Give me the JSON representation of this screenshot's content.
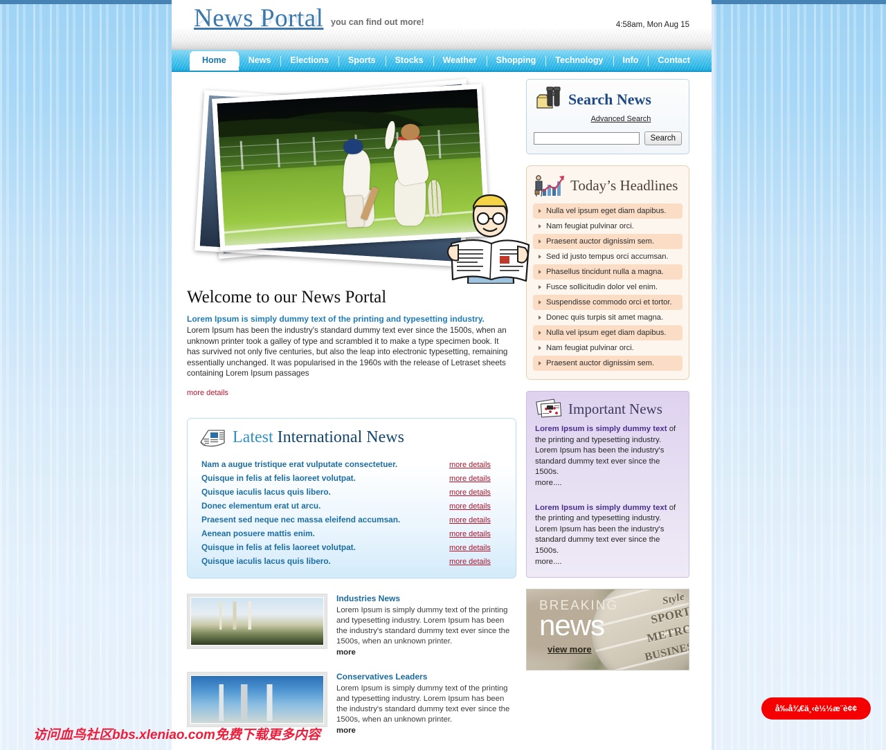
{
  "site": {
    "title": "News Portal",
    "tagline": "you can find out more!",
    "datetime": "4:58am, Mon Aug 15"
  },
  "nav": {
    "items": [
      {
        "label": "Home",
        "active": true
      },
      {
        "label": "News",
        "active": false
      },
      {
        "label": "Elections",
        "active": false
      },
      {
        "label": "Sports",
        "active": false
      },
      {
        "label": "Stocks",
        "active": false
      },
      {
        "label": "Weather",
        "active": false
      },
      {
        "label": "Shopping",
        "active": false
      },
      {
        "label": "Technology",
        "active": false
      },
      {
        "label": "Info",
        "active": false
      },
      {
        "label": "Contact",
        "active": false
      }
    ]
  },
  "hero": {
    "alt": "cricket-match-photo-stack"
  },
  "welcome": {
    "title": "Welcome to our News Portal",
    "lead": "Lorem Ipsum is simply dummy text of the printing and typesetting industry.",
    "body": "Lorem Ipsum has been the industry's standard dummy text ever since the 1500s, when an unknown printer took a galley of type and scrambled it to make a type specimen book. It has survived not only five centuries, but also the leap into electronic typesetting, remaining essentially unchanged. It was popularised in the 1960s with the release of Letraset sheets containing Lorem Ipsum passages",
    "more_label": "more details"
  },
  "international": {
    "title_highlight": "Latest",
    "title_rest": " International News",
    "more_label": "more details",
    "items": [
      "Nam a augue tristique erat vulputate consectetuer.",
      "Quisque in felis at felis laoreet volutpat.",
      "Quisque iaculis lacus quis libero.",
      "Donec elementum erat ut arcu.",
      "Praesent sed neque nec massa eleifend accumsan.",
      "Aenean posuere mattis enim.",
      "Quisque in felis at felis laoreet volutpat.",
      "Quisque iaculis lacus quis libero."
    ]
  },
  "stories": [
    {
      "title": "Industries News",
      "body": "Lorem Ipsum is simply dummy text of the printing and typesetting industry. Lorem Ipsum has been the industry's standard dummy text ever since the 1500s, when an unknown printer.",
      "more_label": "more"
    },
    {
      "title": "Conservatives Leaders",
      "body": "Lorem Ipsum is simply dummy text of the printing and typesetting industry. Lorem Ipsum has been the industry's standard dummy text ever since the 1500s, when an unknown printer.",
      "more_label": "more"
    }
  ],
  "search": {
    "title": "Search News",
    "advanced_label": "Advanced Search",
    "input_value": "",
    "input_placeholder": "",
    "button_label": "Search"
  },
  "headlines": {
    "title": "Today’s Headlines",
    "items": [
      "Nulla vel ipsum eget diam dapibus.",
      "Nam feugiat pulvinar orci.",
      "Praesent auctor dignissim sem.",
      "Sed id justo tempus orci accumsan.",
      "Phasellus tincidunt nulla a magna.",
      "Fusce sollicitudin dolor vel enim.",
      "Suspendisse commodo orci et tortor.",
      "Donec quis turpis sit amet magna.",
      "Nulla vel ipsum eget diam dapibus.",
      "Nam feugiat pulvinar orci.",
      "Praesent auctor dignissim sem."
    ]
  },
  "important": {
    "title": "Important News",
    "blocks": [
      {
        "strong": "Lorem Ipsum is simply dummy text",
        "rest": " of the printing and typesetting industry. Lorem Ipsum has been the industry's standard dummy text ever since the 1500s.",
        "more_label": "more...."
      },
      {
        "strong": "Lorem Ipsum is simply dummy text",
        "rest": " of the printing and typesetting industry. Lorem Ipsum has been the industry's standard dummy text ever since the 1500s.",
        "more_label": "more...."
      }
    ]
  },
  "breaking": {
    "kicker": "BREAKING",
    "word": "news",
    "link_label": "view more",
    "magnifier_words": [
      "Style",
      "SPORT",
      "METRO",
      "BUSINES"
    ]
  },
  "overlay": {
    "watermark": "访问血鸟社区bbs.xleniao.com免费下载更多内容",
    "float_button": "å‰å¾€ä¸‹è½½æ¨è¢¢"
  },
  "colors": {
    "brand_blue": "#3c77ad",
    "nav_cyan": "#32b9e8",
    "link_red": "#b4122b",
    "headline_peach": "#fbddc6",
    "important_purple": "#ded2ef",
    "float_button_red": "#f50000"
  }
}
